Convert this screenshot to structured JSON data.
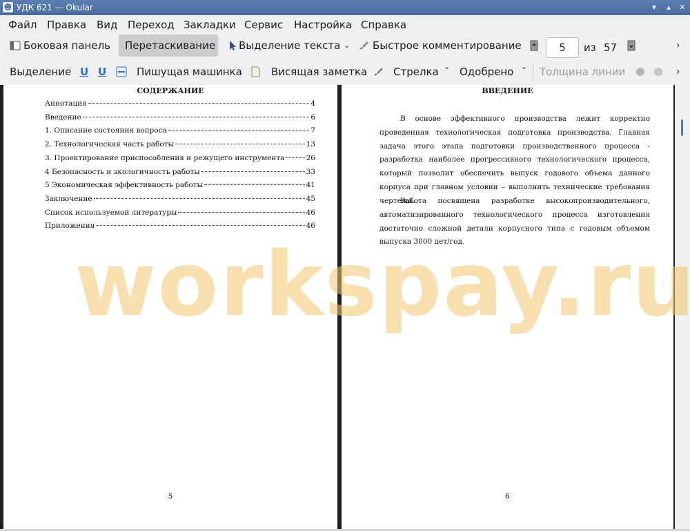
{
  "window": {
    "title": "УДК 621  — Okular"
  },
  "menu": [
    "Файл",
    "Правка",
    "Вид",
    "Переход",
    "Закладки",
    "Сервис",
    "Настройка",
    "Справка"
  ],
  "toolbar1": {
    "sidebar": "Боковая панель",
    "drag": "Перетаскивание",
    "text_select": "Выделение текста",
    "quick_annotations": "Быстрое комментирование",
    "current_page": "5",
    "of_label": "из",
    "total_pages": "57"
  },
  "toolbar2": {
    "highlight": "Выделение",
    "typewriter": "Пишущая машинка",
    "popup_note": "Висящая заметка",
    "arrow": "Стрелка",
    "stamp": "Одобрено",
    "line_width": "Толщина линии"
  },
  "document": {
    "left_page": {
      "heading": "СОДЕРЖАНИЕ",
      "toc": [
        {
          "title": "Аннотация",
          "page": "4"
        },
        {
          "title": "Введение",
          "page": "6"
        },
        {
          "title": "1. Описание состояния вопроса",
          "page": "7"
        },
        {
          "title": "2. Технологическая часть работы",
          "page": "13"
        },
        {
          "title": "3. Проектирование приспособления и режущего инструмента",
          "page": "26"
        },
        {
          "title": "4 Безопасность и экологичность работы",
          "page": "33"
        },
        {
          "title": "5 Экономическая эффективность работы",
          "page": "41"
        },
        {
          "title": "Заключение",
          "page": "45"
        },
        {
          "title": "Список используемой литературы",
          "page": "46"
        },
        {
          "title": "Приложения",
          "page": "46"
        }
      ],
      "page_number": "5"
    },
    "right_page": {
      "heading": "ВВЕДЕНИЕ",
      "paragraphs": [
        "В основе эффективного производства лежит корректно проведенная технологическая подготовка производства. Главная задача этого этапа подготовки производственного процесса - разработка наиболее прогрессивного технологического процесса, который позволит обеспечить выпуск годового объема данного корпуса при главном условии – выполнить технические требования чертежа.",
        "Работа посвящена разработке высокопроизводительного, автоматизированного технологического процесса изготовления достаточно сложной детали корпусного типа с годовым объемом выпуска 3000 дет/год."
      ],
      "page_number": "6"
    },
    "watermark": "workspay.ru"
  },
  "icons": {
    "app": "okular-icon",
    "sidebar": "sidebar-icon",
    "text_select": "cursor-icon",
    "quick_annotations": "brush-icon",
    "prev_page": "page-up-icon",
    "next_page": "page-down-icon"
  }
}
